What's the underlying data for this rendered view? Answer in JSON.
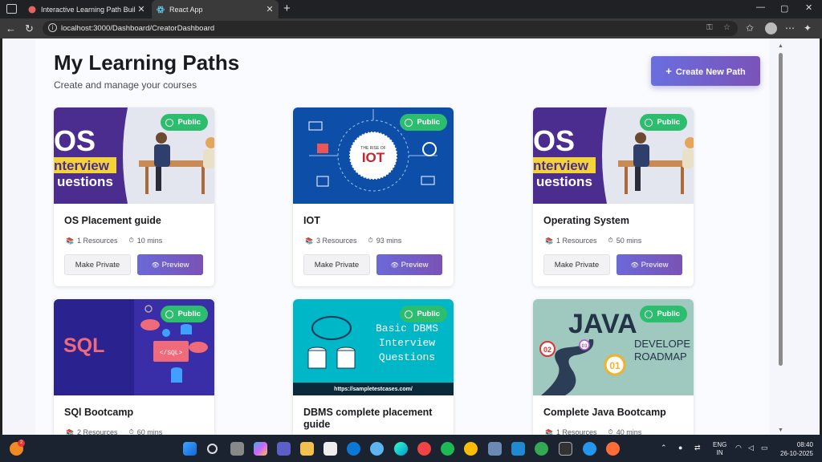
{
  "browser": {
    "tabs": [
      {
        "title": "Interactive Learning Path Builder..."
      },
      {
        "title": "React App"
      }
    ],
    "url": "localhost:3000/Dashboard/CreatorDashboard"
  },
  "page": {
    "title": "My Learning Paths",
    "subtitle": "Create and manage your courses",
    "create_button": "Create New Path",
    "create_icon": "+"
  },
  "courses": [
    {
      "title": "OS Placement guide",
      "visibility": "Public",
      "resources": "1 Resources",
      "duration": "10 mins",
      "private_label": "Make Private",
      "preview_label": "Preview",
      "thumb": "os-interview-questions"
    },
    {
      "title": "IOT",
      "visibility": "Public",
      "resources": "3 Resources",
      "duration": "93 mins",
      "private_label": "Make Private",
      "preview_label": "Preview",
      "thumb": "rise-of-iot"
    },
    {
      "title": "Operating System",
      "visibility": "Public",
      "resources": "1 Resources",
      "duration": "50 mins",
      "private_label": "Make Private",
      "preview_label": "Preview",
      "thumb": "os-interview-questions"
    },
    {
      "title": "SQl Bootcamp",
      "visibility": "Public",
      "resources": "2 Resources",
      "duration": "60 mins",
      "thumb": "sql"
    },
    {
      "title": "DBMS complete placement guide",
      "visibility": "Public",
      "thumb": "basic-dbms"
    },
    {
      "title": "Complete Java Bootcamp",
      "visibility": "Public",
      "resources": "1 Resources",
      "duration": "40 mins",
      "thumb": "java-roadmap"
    }
  ],
  "thumb_text": {
    "os": [
      "OS",
      "nterview",
      "uestions"
    ],
    "iot": [
      "THE RISE OF",
      "IOT"
    ],
    "sql": [
      "SQL",
      "</SQL>"
    ],
    "dbms": [
      "Basic DBMS",
      "Interview",
      "Questions",
      "https://sampletestcases.com/"
    ],
    "java": [
      "JAVA",
      "DEVELOPE",
      "ROADMAP",
      "02",
      "03",
      "01"
    ]
  },
  "taskbar": {
    "lang": [
      "ENG",
      "IN"
    ],
    "time": "08:40",
    "date": "26-10-2025",
    "badge_count": "2"
  },
  "colors": {
    "accent": "#6b69d8",
    "public": "#2dbd6e"
  }
}
